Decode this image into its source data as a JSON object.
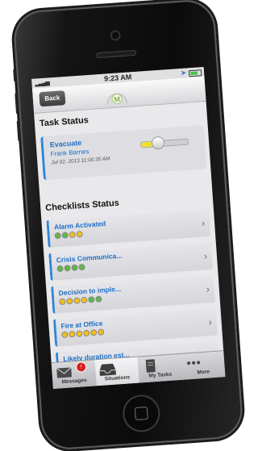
{
  "status_bar": {
    "time": "9:23 AM"
  },
  "nav": {
    "back_label": "Back"
  },
  "task_status": {
    "title": "Task Status",
    "task": {
      "name": "Evacuate",
      "user": "Frank Barnes",
      "date": "Jul 02, 2013 11:00:35 AM",
      "progress": 0.35
    }
  },
  "checklists": {
    "title": "Checklists Status",
    "items": [
      {
        "name": "Alarm Activated",
        "dots": [
          "#5fb84a",
          "#5fb84a",
          "#f0c020",
          "#f0c020"
        ]
      },
      {
        "name": "Crisis Communica...",
        "dots": [
          "#5fb84a",
          "#5fb84a",
          "#5fb84a",
          "#5fb84a"
        ]
      },
      {
        "name": "Decision to imple...",
        "dots": [
          "#f0c020",
          "#f0c020",
          "#f0c020",
          "#f0c020",
          "#5fb84a",
          "#5fb84a"
        ]
      },
      {
        "name": "Fire at Office",
        "dots": [
          "#f0c020",
          "#f0c020",
          "#f0c020",
          "#f0c020",
          "#f0c020",
          "#f0c020"
        ]
      },
      {
        "name": "Likely duration est...",
        "dots": []
      }
    ]
  },
  "tabbar": {
    "tabs": [
      {
        "label": "Messages",
        "icon": "envelope-icon",
        "badge": "!"
      },
      {
        "label": "Situations",
        "icon": "inbox-icon"
      },
      {
        "label": "My Tasks",
        "icon": "notebook-icon"
      },
      {
        "label": "More",
        "icon": "more-icon"
      }
    ]
  },
  "colors": {
    "accent": "#2f86d6",
    "link": "#1f6fc6",
    "badge": "#d52020"
  }
}
